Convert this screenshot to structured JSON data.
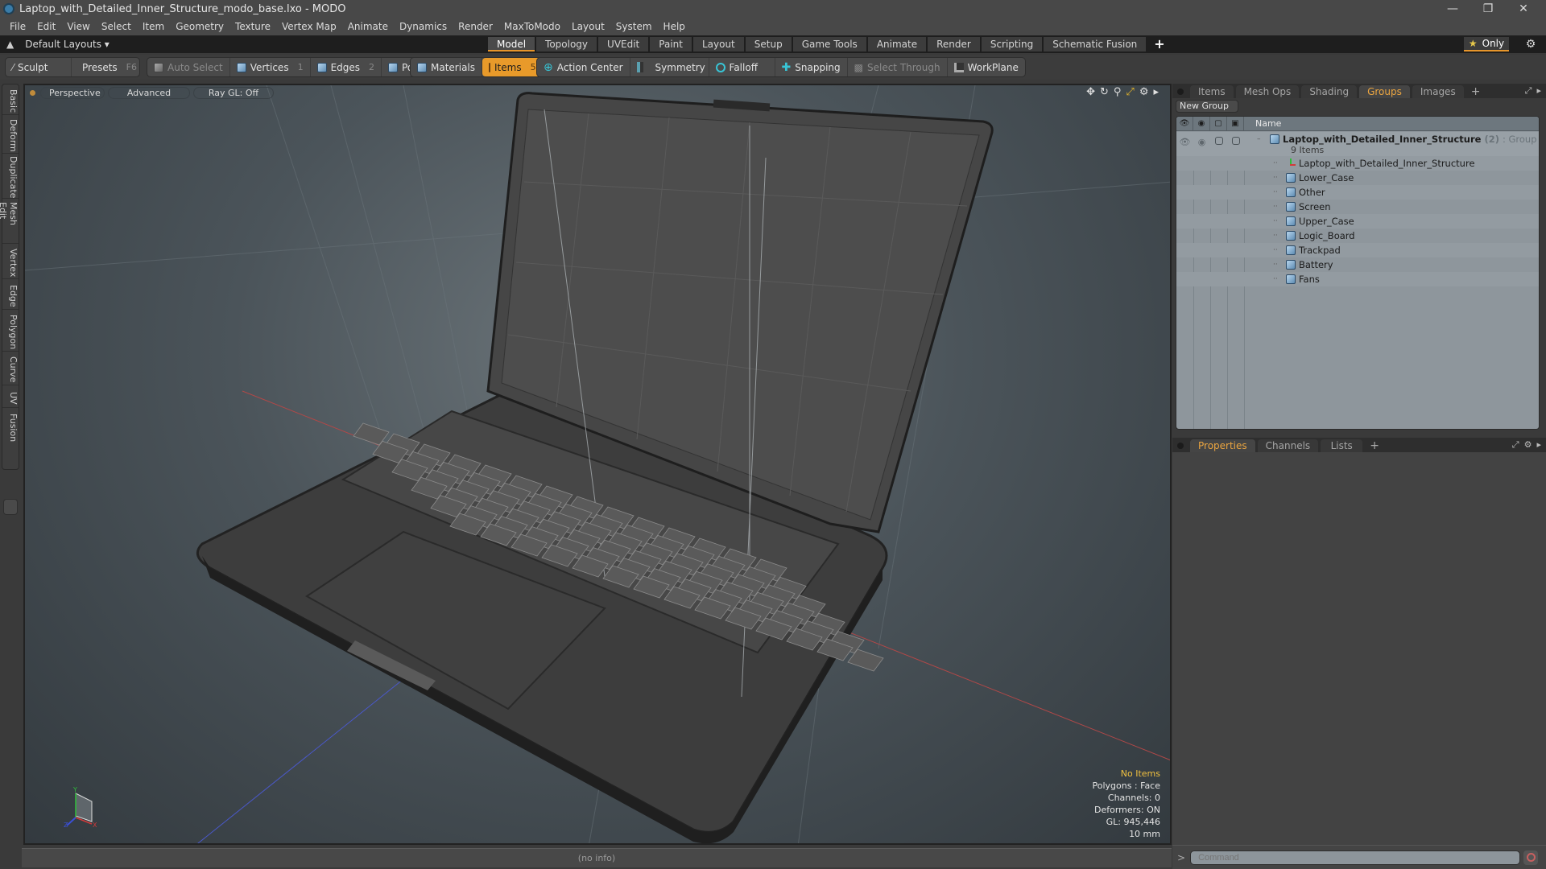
{
  "window": {
    "title": "Laptop_with_Detailed_Inner_Structure_modo_base.lxo - MODO",
    "controls": {
      "minimize": "—",
      "maximize": "❐",
      "close": "✕"
    }
  },
  "menu": [
    "File",
    "Edit",
    "View",
    "Select",
    "Item",
    "Geometry",
    "Texture",
    "Vertex Map",
    "Animate",
    "Dynamics",
    "Render",
    "MaxToModo",
    "Layout",
    "System",
    "Help"
  ],
  "layout_bar": {
    "layouts_label": "Default Layouts ▾",
    "tabs": [
      "Model",
      "Topology",
      "UVEdit",
      "Paint",
      "Layout",
      "Setup",
      "Game Tools",
      "Animate",
      "Render",
      "Scripting",
      "Schematic Fusion"
    ],
    "active_tab": "Model",
    "add_tab": "+",
    "only_label": "Only",
    "only_icon": "★",
    "settings_icon": "⚙"
  },
  "toolbar": {
    "sculpt": "Sculpt",
    "presets": "Presets",
    "presets_key": "F6",
    "auto_select": "Auto Select",
    "vertices": "Vertices",
    "vertices_key": "1",
    "edges": "Edges",
    "edges_key": "2",
    "polygons": "Polygons",
    "materials": "Materials",
    "items": "Items",
    "items_key": "5",
    "action_center": "Action Center",
    "symmetry": "Symmetry",
    "falloff": "Falloff",
    "snapping": "Snapping",
    "select_through": "Select Through",
    "workplane": "WorkPlane"
  },
  "side_tabs": [
    "Basic",
    "Deform",
    "Duplicate",
    "Mesh Edit",
    "Vertex",
    "Edge",
    "Polygon",
    "Curve",
    "UV",
    "Fusion"
  ],
  "viewport": {
    "view": "Perspective",
    "shading": "Advanced",
    "raygl": "Ray GL: Off",
    "info": {
      "selection": "No Items",
      "mode": "Polygons : Face",
      "channels": "Channels: 0",
      "deformers": "Deformers: ON",
      "gl": "GL: 945,446",
      "grid": "10 mm"
    },
    "axis": {
      "x": "X",
      "y": "Y",
      "z": "Z"
    }
  },
  "status_bar": {
    "text": "(no info)"
  },
  "groups_panel": {
    "tabs": [
      "Items",
      "Mesh Ops",
      "Shading",
      "Groups",
      "Images"
    ],
    "active_tab": "Groups",
    "add_tab": "+",
    "new_group": "New Group",
    "column_name": "Name",
    "group": {
      "name": "Laptop_with_Detailed_Inner_Structure",
      "count": "(2)",
      "type": ": Group",
      "items_label": "9 Items"
    },
    "items": [
      {
        "name": "Laptop_with_Detailed_Inner_Structure",
        "icon": "locator"
      },
      {
        "name": "Lower_Case",
        "icon": "mesh"
      },
      {
        "name": "Other",
        "icon": "mesh"
      },
      {
        "name": "Screen",
        "icon": "mesh"
      },
      {
        "name": "Upper_Case",
        "icon": "mesh"
      },
      {
        "name": "Logic_Board",
        "icon": "mesh"
      },
      {
        "name": "Trackpad",
        "icon": "mesh"
      },
      {
        "name": "Battery",
        "icon": "mesh"
      },
      {
        "name": "Fans",
        "icon": "mesh"
      }
    ]
  },
  "properties_panel": {
    "tabs": [
      "Properties",
      "Channels",
      "Lists"
    ],
    "active_tab": "Properties",
    "add_tab": "+"
  },
  "command": {
    "prompt": ">",
    "placeholder": "Command"
  },
  "colors": {
    "accent": "#e89a2a",
    "tab_active_text": "#eba540",
    "info_highlight": "#f0c040",
    "axis_x": "#d23a3a",
    "axis_y": "#2fbf3a",
    "axis_z": "#3b4fd6"
  }
}
